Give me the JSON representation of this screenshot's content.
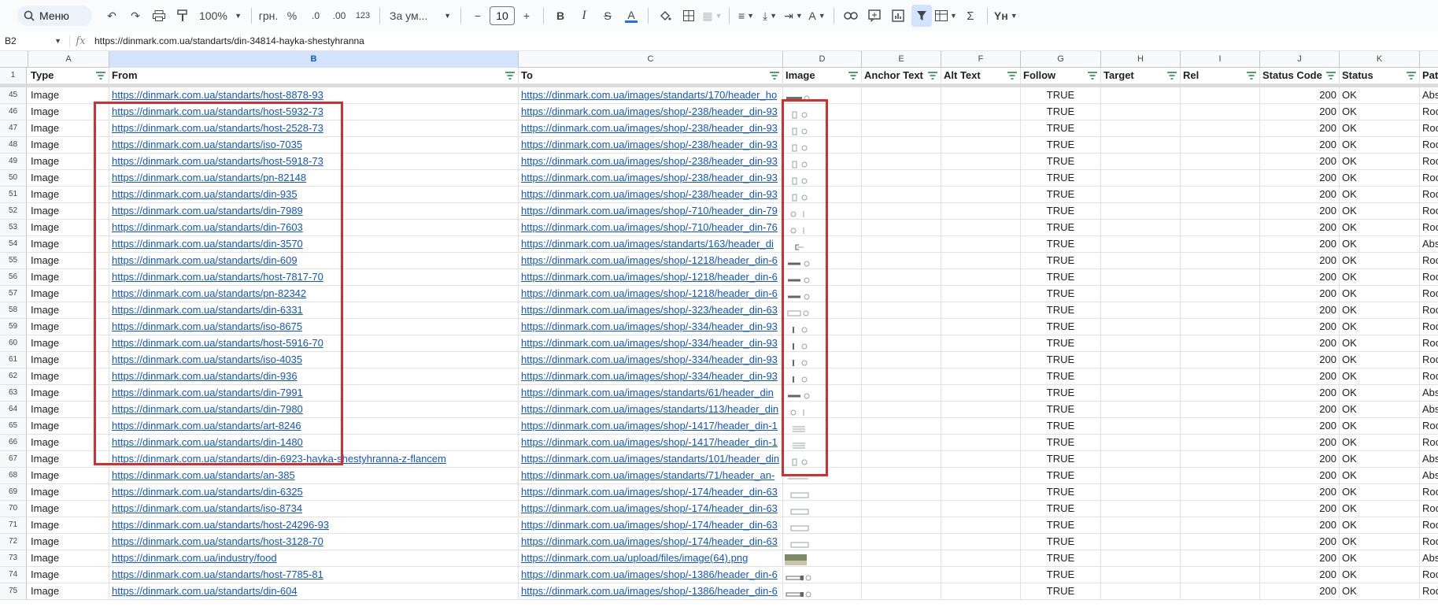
{
  "toolbar": {
    "menu_label": "Меню",
    "zoom": "100%",
    "currency": "грн.",
    "percent": "%",
    "dec_less": ".0",
    "dec_more": ".00",
    "number_format": "123",
    "font_name": "За ум...",
    "font_size": "10",
    "bold": "B",
    "italic": "I",
    "strike": "S",
    "text_color": "A",
    "sigma": "Σ",
    "language": "Yн"
  },
  "formula_bar": {
    "cell_ref": "B2",
    "fx": "fx",
    "value": "https://dinmark.com.ua/standarts/din-34814-hayka-shestyhranna"
  },
  "columns": [
    "A",
    "B",
    "C",
    "D",
    "E",
    "F",
    "G",
    "H",
    "I",
    "J",
    "K",
    ""
  ],
  "headers": [
    "Type",
    "From",
    "To",
    "Image",
    "Anchor Text",
    "Alt Text",
    "Follow",
    "Target",
    "Rel",
    "Status Code",
    "Status",
    "Pat"
  ],
  "rows": [
    {
      "n": "45",
      "type": "Image",
      "from": "https://dinmark.com.ua/standarts/host-8878-93",
      "to": "https://dinmark.com.ua/images/standarts/170/header_ho",
      "follow": "TRUE",
      "code": "200",
      "status": "OK",
      "path": "Abs"
    },
    {
      "n": "46",
      "type": "Image",
      "from": "https://dinmark.com.ua/standarts/host-5932-73",
      "to": "https://dinmark.com.ua/images/shop/-238/header_din-93",
      "follow": "TRUE",
      "code": "200",
      "status": "OK",
      "path": "Roo"
    },
    {
      "n": "47",
      "type": "Image",
      "from": "https://dinmark.com.ua/standarts/host-2528-73",
      "to": "https://dinmark.com.ua/images/shop/-238/header_din-93",
      "follow": "TRUE",
      "code": "200",
      "status": "OK",
      "path": "Roo"
    },
    {
      "n": "48",
      "type": "Image",
      "from": "https://dinmark.com.ua/standarts/iso-7035",
      "to": "https://dinmark.com.ua/images/shop/-238/header_din-93",
      "follow": "TRUE",
      "code": "200",
      "status": "OK",
      "path": "Roo"
    },
    {
      "n": "49",
      "type": "Image",
      "from": "https://dinmark.com.ua/standarts/host-5918-73",
      "to": "https://dinmark.com.ua/images/shop/-238/header_din-93",
      "follow": "TRUE",
      "code": "200",
      "status": "OK",
      "path": "Roo"
    },
    {
      "n": "50",
      "type": "Image",
      "from": "https://dinmark.com.ua/standarts/pn-82148",
      "to": "https://dinmark.com.ua/images/shop/-238/header_din-93",
      "follow": "TRUE",
      "code": "200",
      "status": "OK",
      "path": "Roo"
    },
    {
      "n": "51",
      "type": "Image",
      "from": "https://dinmark.com.ua/standarts/din-935",
      "to": "https://dinmark.com.ua/images/shop/-238/header_din-93",
      "follow": "TRUE",
      "code": "200",
      "status": "OK",
      "path": "Roo"
    },
    {
      "n": "52",
      "type": "Image",
      "from": "https://dinmark.com.ua/standarts/din-7989",
      "to": "https://dinmark.com.ua/images/shop/-710/header_din-79",
      "follow": "TRUE",
      "code": "200",
      "status": "OK",
      "path": "Roo"
    },
    {
      "n": "53",
      "type": "Image",
      "from": "https://dinmark.com.ua/standarts/din-7603",
      "to": "https://dinmark.com.ua/images/shop/-710/header_din-76",
      "follow": "TRUE",
      "code": "200",
      "status": "OK",
      "path": "Roo"
    },
    {
      "n": "54",
      "type": "Image",
      "from": "https://dinmark.com.ua/standarts/din-3570",
      "to": "https://dinmark.com.ua/images/standarts/163/header_di",
      "follow": "TRUE",
      "code": "200",
      "status": "OK",
      "path": "Abs"
    },
    {
      "n": "55",
      "type": "Image",
      "from": "https://dinmark.com.ua/standarts/din-609",
      "to": "https://dinmark.com.ua/images/shop/-1218/header_din-6",
      "follow": "TRUE",
      "code": "200",
      "status": "OK",
      "path": "Roo"
    },
    {
      "n": "56",
      "type": "Image",
      "from": "https://dinmark.com.ua/standarts/host-7817-70",
      "to": "https://dinmark.com.ua/images/shop/-1218/header_din-6",
      "follow": "TRUE",
      "code": "200",
      "status": "OK",
      "path": "Roo"
    },
    {
      "n": "57",
      "type": "Image",
      "from": "https://dinmark.com.ua/standarts/pn-82342",
      "to": "https://dinmark.com.ua/images/shop/-1218/header_din-6",
      "follow": "TRUE",
      "code": "200",
      "status": "OK",
      "path": "Roo"
    },
    {
      "n": "58",
      "type": "Image",
      "from": "https://dinmark.com.ua/standarts/din-6331",
      "to": "https://dinmark.com.ua/images/shop/-323/header_din-63",
      "follow": "TRUE",
      "code": "200",
      "status": "OK",
      "path": "Roo"
    },
    {
      "n": "59",
      "type": "Image",
      "from": "https://dinmark.com.ua/standarts/iso-8675",
      "to": "https://dinmark.com.ua/images/shop/-334/header_din-93",
      "follow": "TRUE",
      "code": "200",
      "status": "OK",
      "path": "Roo"
    },
    {
      "n": "60",
      "type": "Image",
      "from": "https://dinmark.com.ua/standarts/host-5916-70",
      "to": "https://dinmark.com.ua/images/shop/-334/header_din-93",
      "follow": "TRUE",
      "code": "200",
      "status": "OK",
      "path": "Roo"
    },
    {
      "n": "61",
      "type": "Image",
      "from": "https://dinmark.com.ua/standarts/iso-4035",
      "to": "https://dinmark.com.ua/images/shop/-334/header_din-93",
      "follow": "TRUE",
      "code": "200",
      "status": "OK",
      "path": "Roo"
    },
    {
      "n": "62",
      "type": "Image",
      "from": "https://dinmark.com.ua/standarts/din-936",
      "to": "https://dinmark.com.ua/images/shop/-334/header_din-93",
      "follow": "TRUE",
      "code": "200",
      "status": "OK",
      "path": "Roo"
    },
    {
      "n": "63",
      "type": "Image",
      "from": "https://dinmark.com.ua/standarts/din-7991",
      "to": "https://dinmark.com.ua/images/standarts/61/header_din",
      "follow": "TRUE",
      "code": "200",
      "status": "OK",
      "path": "Abs"
    },
    {
      "n": "64",
      "type": "Image",
      "from": "https://dinmark.com.ua/standarts/din-7980",
      "to": "https://dinmark.com.ua/images/standarts/113/header_din",
      "follow": "TRUE",
      "code": "200",
      "status": "OK",
      "path": "Abs"
    },
    {
      "n": "65",
      "type": "Image",
      "from": "https://dinmark.com.ua/standarts/art-8246",
      "to": "https://dinmark.com.ua/images/shop/-1417/header_din-1",
      "follow": "TRUE",
      "code": "200",
      "status": "OK",
      "path": "Roo"
    },
    {
      "n": "66",
      "type": "Image",
      "from": "https://dinmark.com.ua/standarts/din-1480",
      "to": "https://dinmark.com.ua/images/shop/-1417/header_din-1",
      "follow": "TRUE",
      "code": "200",
      "status": "OK",
      "path": "Roo"
    },
    {
      "n": "67",
      "type": "Image",
      "from": "https://dinmark.com.ua/standarts/din-6923-hayka-shestyhranna-z-flancem",
      "to": "https://dinmark.com.ua/images/standarts/101/header_din",
      "follow": "TRUE",
      "code": "200",
      "status": "OK",
      "path": "Abs"
    },
    {
      "n": "68",
      "type": "Image",
      "from": "https://dinmark.com.ua/standarts/an-385",
      "to": "https://dinmark.com.ua/images/standarts/71/header_an-",
      "follow": "TRUE",
      "code": "200",
      "status": "OK",
      "path": "Abs"
    },
    {
      "n": "69",
      "type": "Image",
      "from": "https://dinmark.com.ua/standarts/din-6325",
      "to": "https://dinmark.com.ua/images/shop/-174/header_din-63",
      "follow": "TRUE",
      "code": "200",
      "status": "OK",
      "path": "Roo"
    },
    {
      "n": "70",
      "type": "Image",
      "from": "https://dinmark.com.ua/standarts/iso-8734",
      "to": "https://dinmark.com.ua/images/shop/-174/header_din-63",
      "follow": "TRUE",
      "code": "200",
      "status": "OK",
      "path": "Roo"
    },
    {
      "n": "71",
      "type": "Image",
      "from": "https://dinmark.com.ua/standarts/host-24296-93",
      "to": "https://dinmark.com.ua/images/shop/-174/header_din-63",
      "follow": "TRUE",
      "code": "200",
      "status": "OK",
      "path": "Roo"
    },
    {
      "n": "72",
      "type": "Image",
      "from": "https://dinmark.com.ua/standarts/host-3128-70",
      "to": "https://dinmark.com.ua/images/shop/-174/header_din-63",
      "follow": "TRUE",
      "code": "200",
      "status": "OK",
      "path": "Roo"
    },
    {
      "n": "73",
      "type": "Image",
      "from": "https://dinmark.com.ua/industry/food",
      "to": "https://dinmark.com.ua/upload/files/image(64).png",
      "follow": "TRUE",
      "code": "200",
      "status": "OK",
      "path": "Abs"
    },
    {
      "n": "74",
      "type": "Image",
      "from": "https://dinmark.com.ua/standarts/host-7785-81",
      "to": "https://dinmark.com.ua/images/shop/-1386/header_din-6",
      "follow": "TRUE",
      "code": "200",
      "status": "OK",
      "path": "Roo"
    },
    {
      "n": "75",
      "type": "Image",
      "from": "https://dinmark.com.ua/standarts/din-604",
      "to": "https://dinmark.com.ua/images/shop/-1386/header_din-6",
      "follow": "TRUE",
      "code": "200",
      "status": "OK",
      "path": "Roo"
    }
  ],
  "colors": {
    "link": "#1155cc",
    "highlight": "#d32f2f",
    "selected_col": "#d3e3fd",
    "filter_green": "#188038"
  }
}
